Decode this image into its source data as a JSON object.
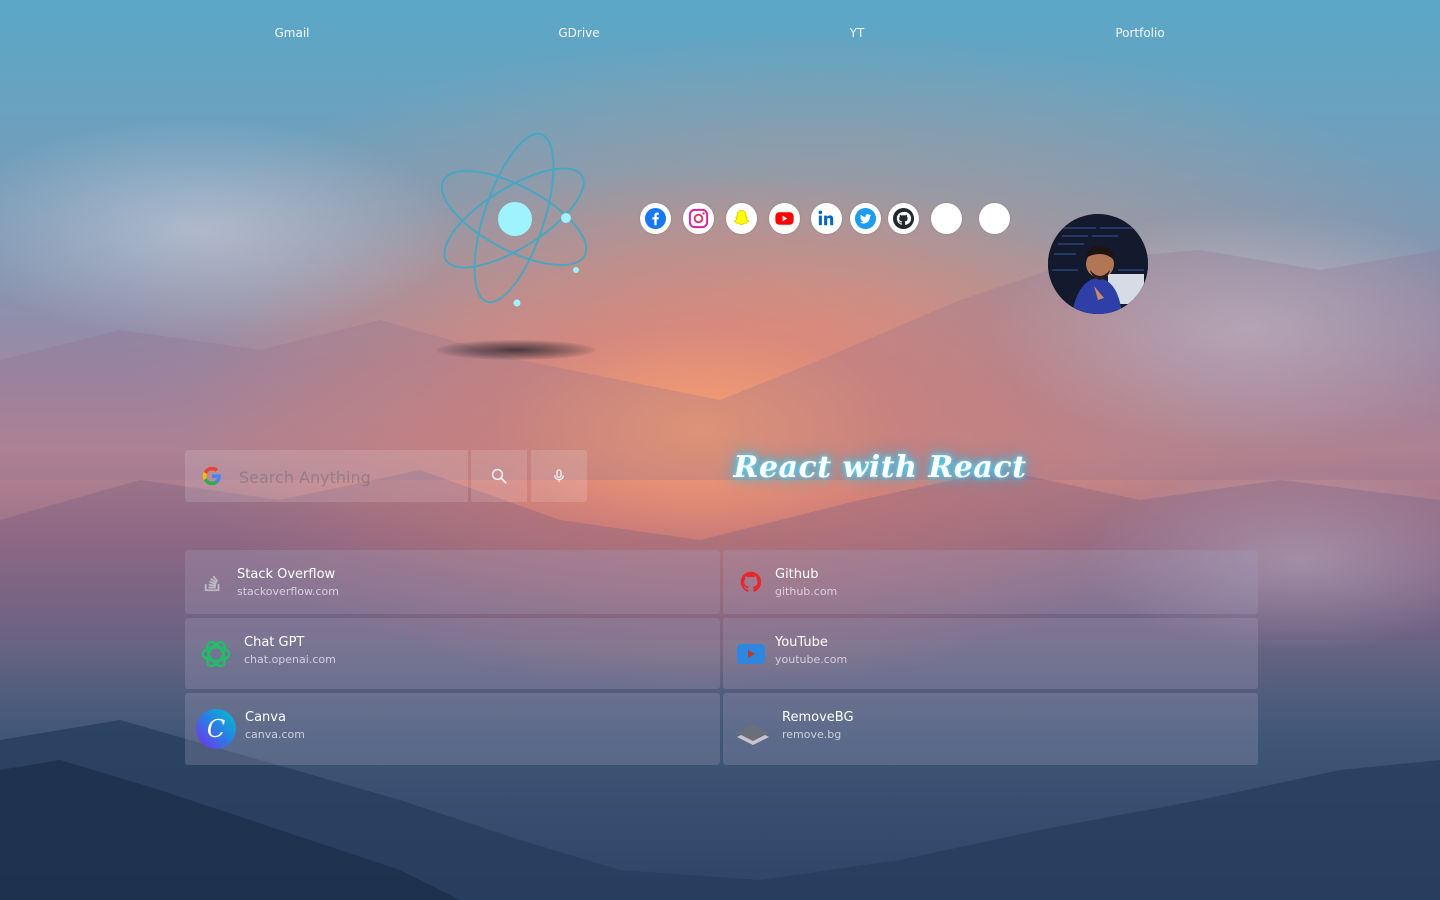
{
  "top_links": [
    "Gmail",
    "GDrive",
    "YT",
    "Portfolio"
  ],
  "search": {
    "placeholder": "Search Anything"
  },
  "tagline": "React with React",
  "socials": [
    "facebook",
    "instagram",
    "snapchat",
    "youtube",
    "linkedin",
    "twitter",
    "github",
    "blank",
    "blank"
  ],
  "shortcuts": [
    {
      "name": "Stack Overflow",
      "url": "stackoverflow.com",
      "icon": "stackoverflow-icon"
    },
    {
      "name": "Github",
      "url": "github.com",
      "icon": "github-icon"
    },
    {
      "name": "Chat GPT",
      "url": "chat.openai.com",
      "icon": "openai-icon"
    },
    {
      "name": "YouTube",
      "url": "youtube.com",
      "icon": "youtube-icon"
    },
    {
      "name": "Canva",
      "url": "canva.com",
      "icon": "canva-icon"
    },
    {
      "name": "RemoveBG",
      "url": "remove.bg",
      "icon": "removebg-icon"
    }
  ],
  "colors": {
    "atom": "#5fd6ea",
    "tagline_glow": "#3ac6f0",
    "youtube_red": "#ff0000",
    "facebook_blue": "#1877f2"
  }
}
